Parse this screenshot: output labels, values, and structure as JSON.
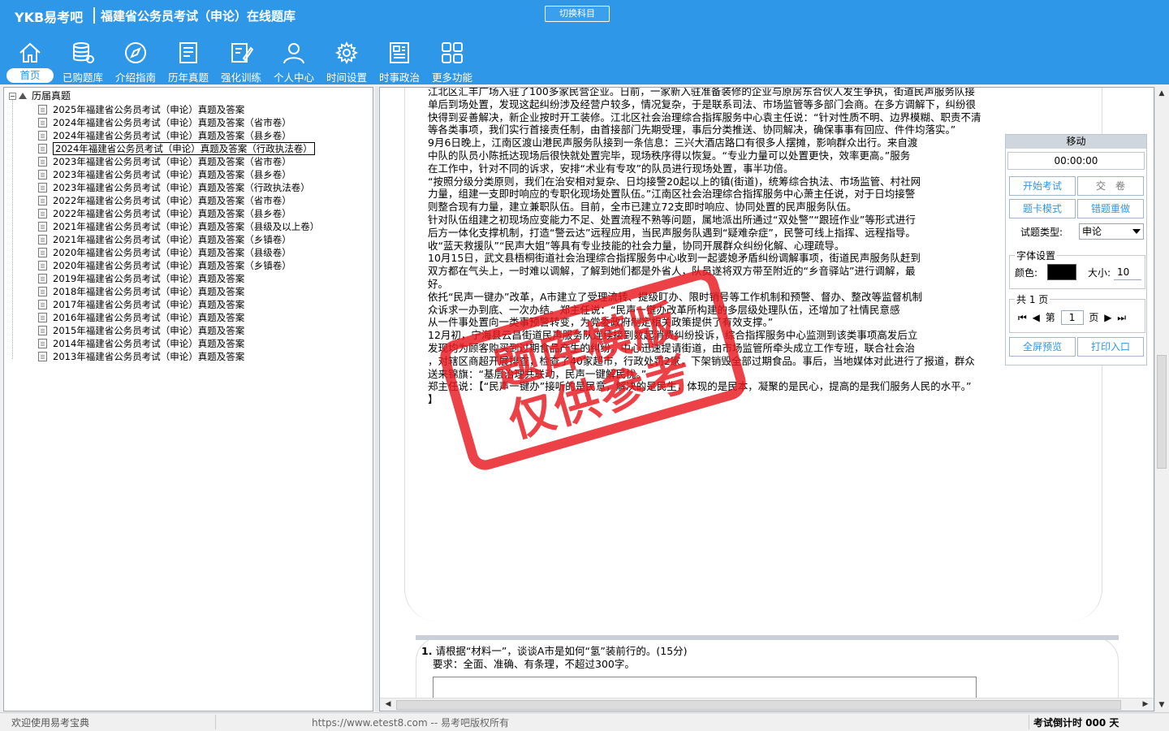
{
  "header": {
    "logo": "YKB易考吧",
    "title": "福建省公务员考试（申论）在线题库",
    "switch_subject": "切换科目"
  },
  "toolbar": [
    {
      "label": "首页",
      "icon": "home-icon"
    },
    {
      "label": "已购题库",
      "icon": "database-icon"
    },
    {
      "label": "介绍指南",
      "icon": "compass-icon"
    },
    {
      "label": "历年真题",
      "icon": "paper-list-icon"
    },
    {
      "label": "强化训练",
      "icon": "pencil-note-icon"
    },
    {
      "label": "个人中心",
      "icon": "user-icon"
    },
    {
      "label": "时间设置",
      "icon": "gear-icon"
    },
    {
      "label": "时事政治",
      "icon": "newspaper-icon"
    },
    {
      "label": "更多功能",
      "icon": "grid-icon"
    }
  ],
  "tree": {
    "root_label": "历届真题",
    "items": [
      "2025年福建省公务员考试（申论）真题及答案",
      "2024年福建省公务员考试（申论）真题及答案（省市卷）",
      "2024年福建省公务员考试（申论）真题及答案（县乡卷）",
      "2024年福建省公务员考试（申论）真题及答案（行政执法卷）",
      "2023年福建省公务员考试（申论）真题及答案（省市卷）",
      "2023年福建省公务员考试（申论）真题及答案（县乡卷）",
      "2023年福建省公务员考试（申论）真题及答案（行政执法卷）",
      "2022年福建省公务员考试（申论）真题及答案（省市卷）",
      "2022年福建省公务员考试（申论）真题及答案（县乡卷）",
      "2021年福建省公务员考试（申论）真题及答案（县级及以上卷）",
      "2021年福建省公务员考试（申论）真题及答案（乡镇卷）",
      "2020年福建省公务员考试（申论）真题及答案（县级卷）",
      "2020年福建省公务员考试（申论）真题及答案（乡镇卷）",
      "2019年福建省公务员考试（申论）真题及答案",
      "2018年福建省公务员考试（申论）真题及答案",
      "2017年福建省公务员考试（申论）真题及答案",
      "2016年福建省公务员考试（申论）真题及答案",
      "2015年福建省公务员考试（申论）真题及答案",
      "2014年福建省公务员考试（申论）真题及答案",
      "2013年福建省公务员考试（申论）真题及答案"
    ]
  },
  "material_lines": [
    "江北区汇丰广场入驻了100多家民营企业。日前，一家新入驻准备装修的企业与原房东合伙人发生争执，街道民声服务队接",
    "单后到场处置，发现这起纠纷涉及经营户较多，情况复杂，于是联系司法、市场监管等多部门会商。在多方调解下，纠纷很",
    "快得到妥善解决，新企业按时开工装修。江北区社会治理综合指挥服务中心袁主任说：“针对性质不明、边界模糊、职责不清",
    "等各类事项，我们实行首接责任制，由首接部门先期受理，事后分类推送、协同解决，确保事事有回应、件件均落实。”",
    "9月6日晚上，江南区渡山港民声服务队接到一条信息：三兴大酒店路口有很多人摆摊，影响群众出行。来自渡",
    "中队的队员小陈抵达现场后很快就处置完毕，现场秩序得以恢复。“专业力量可以处置更快，效率更高。”服务",
    "在工作中，针对不同的诉求，安排“术业有专攻”的队员进行现场处置，事半功倍。",
    "“按照分级分类原则，我们在治安相对复杂、日均接警20起以上的镇(街道)，统筹综合执法、市场监管、村社网",
    "力量，组建一支即时响应的专职化现场处置队伍。”江南区社会治理综合指挥服务中心萧主任说，对于日均接警",
    "则整合现有力量，建立兼职队伍。目前，全市已建立72支即时响应、协同处置的民声服务队伍。",
    "针对队伍组建之初现场应变能力不足、处置流程不熟等问题，属地派出所通过“双处警”“跟班作业”等形式进行",
    "后方一体化支撑机制，打造“警云达”远程应用，当民声服务队遇到“疑难杂症”，民警可线上指挥、远程指导。",
    "收“蓝天救援队”“民声大姐”等具有专业技能的社会力量，协同开展群众纠纷化解、心理疏导。",
    "10月15日，武文县梧桐街道社会治理综合指挥服务中心收到一起婆媳矛盾纠纷调解事项，街道民声服务队赶到",
    "双方都在气头上，一时难以调解，了解到她们都是外省人，队员遂将双方带至附近的“乡音驿站”进行调解，最",
    "好。",
    "依托“民声一键办”改革，A市建立了受理流转、提级盯办、限时销号等工作机制和预警、督办、整改等监督机制",
    "众诉求一办到底、一次办结。郑主任说：“民声一键办改革所构建的多层级处理队伍，还增加了社情民意感",
    "从一件事处置向一类事预警转变，为党委政府制定相关政策提供了有效支撑。”",
    "12月初，宁海县云昌街道民声服务队连续接到数起消费纠纷投诉，综合指挥服务中心监测到该类事项高发后立",
    "发现均为顾客购买到过期食品产生的纠纷。中心迅速提请街道，由市场监管所牵头成立工作专班，联合社会治",
    "，对辖区商超开展排查，检查了40家超市，行政处罚2家，下架销毁全部过期食品。事后，当地媒体对此进行了报道，群众",
    "送来锦旗：“基层治理共联动，民声一键解民忧。”",
    "郑主任说：【“民声一键办”接听的是民意，解决的是民生，体现的是民本，凝聚的是民心，提高的是我们服务人民的水平。”",
    "】"
  ],
  "question": {
    "number": "1.",
    "text": "请根据“材料一”，谈谈A市是如何“氢”装前行的。(15分)",
    "requirement": "要求：全面、准确、有条理，不超过300字。"
  },
  "stamp": {
    "line1": "题库模版",
    "line2": "仅供参考"
  },
  "control_panel": {
    "title": "移动",
    "timer": "00:00:00",
    "start_exam": "开始考试",
    "submit": "交　卷",
    "card_mode": "题卡模式",
    "wrong_redo": "错题重做",
    "type_label": "试题类型:",
    "type_value": "申论",
    "font_legend": "字体设置",
    "color_label": "颜色:",
    "color_value": "#000000",
    "size_label": "大小:",
    "size_value": "10",
    "pages_legend": "共 1 页",
    "page_prefix": "第",
    "page_value": "1",
    "page_suffix": "页",
    "fullscreen": "全屏预览",
    "print": "打印入口"
  },
  "statusbar": {
    "welcome": "欢迎使用易考宝典",
    "copyright": "https://www.etest8.com -- 易考吧版权所有",
    "countdown": "考试倒计时 000 天"
  },
  "colors": {
    "header_bg": "#2f97e8",
    "stamp": "#e8191f"
  }
}
